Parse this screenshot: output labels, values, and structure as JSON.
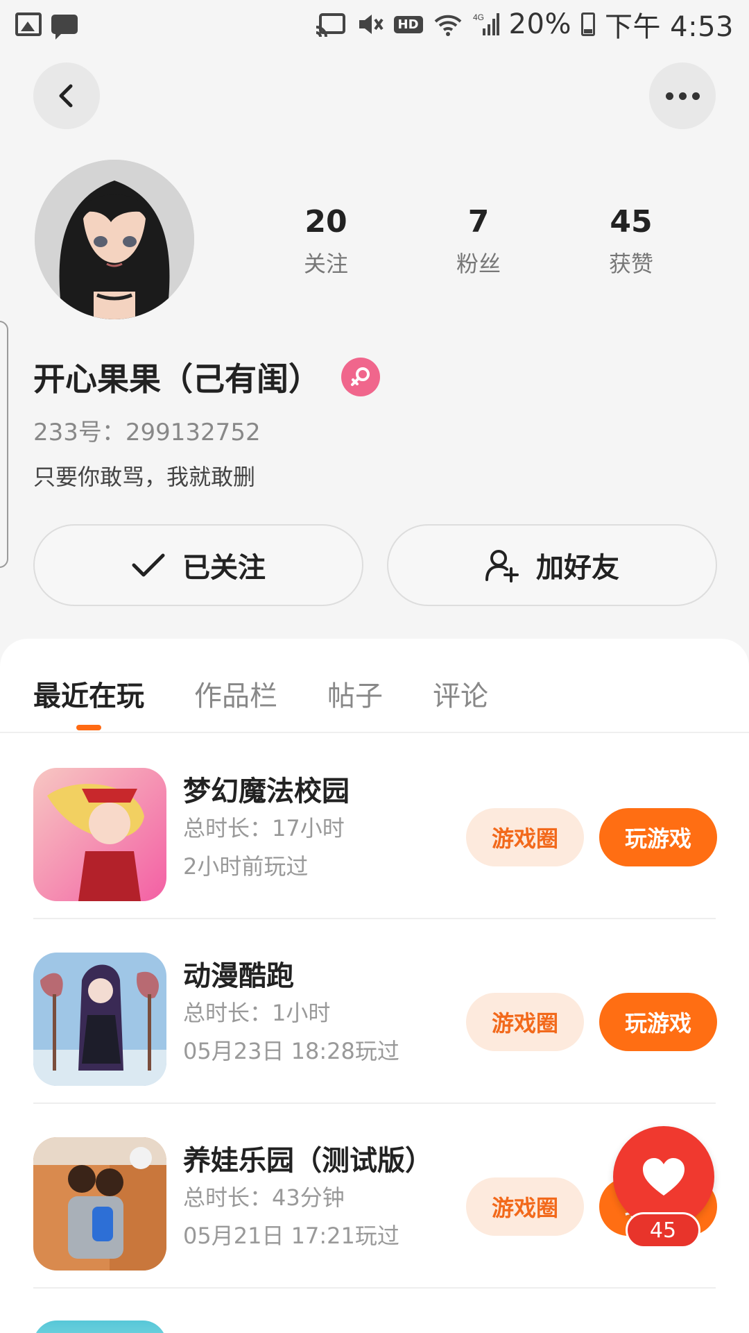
{
  "status_bar": {
    "battery": "20%",
    "time": "下午 4:53",
    "hd_badge": "HD",
    "network": "4G"
  },
  "profile": {
    "stats": [
      {
        "value": "20",
        "label": "关注"
      },
      {
        "value": "7",
        "label": "粉丝"
      },
      {
        "value": "45",
        "label": "获赞"
      }
    ],
    "nickname": "开心果果（己有闺）",
    "uid": "233号：299132752",
    "bio": "只要你敢骂，我就敢删",
    "follow_label": "已关注",
    "add_friend_label": "加好友",
    "gender_color": "#f0668c"
  },
  "tabs": [
    {
      "label": "最近在玩",
      "active": true
    },
    {
      "label": "作品栏",
      "active": false
    },
    {
      "label": "帖子",
      "active": false
    },
    {
      "label": "评论",
      "active": false
    }
  ],
  "games": [
    {
      "title": "梦幻魔法校园",
      "duration": "总时长：17小时",
      "last_played": "2小时前玩过",
      "circle_label": "游戏圈",
      "play_label": "玩游戏"
    },
    {
      "title": "动漫酷跑",
      "duration": "总时长：1小时",
      "last_played": "05月23日 18:28玩过",
      "circle_label": "游戏圈",
      "play_label": "玩游戏"
    },
    {
      "title": "养娃乐园（测试版）",
      "duration": "总时长：43分钟",
      "last_played": "05月21日 17:21玩过",
      "circle_label": "游戏圈",
      "play_label": "玩游戏"
    }
  ],
  "like_fab": {
    "count": "45",
    "icon": "heart-icon"
  },
  "colors": {
    "accent": "#ff6e13",
    "accent_light": "#fdeadd",
    "like_red": "#f0392f"
  }
}
